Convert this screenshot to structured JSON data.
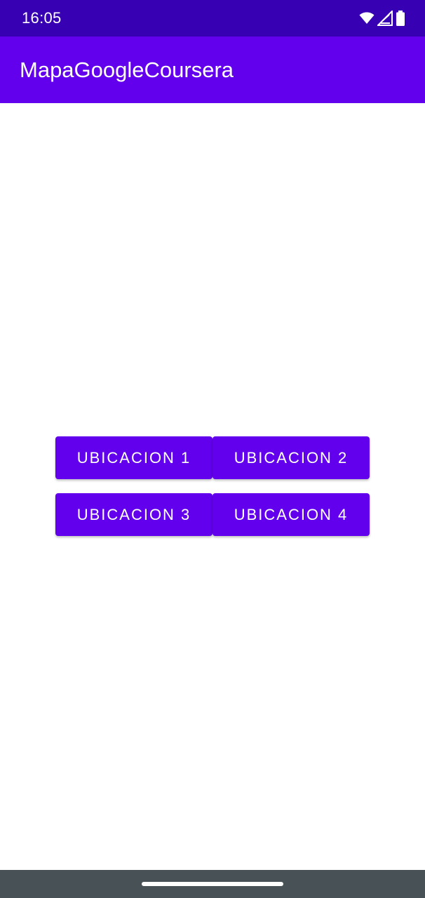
{
  "status_bar": {
    "time": "16:05",
    "icons": [
      "wifi-icon",
      "signal-icon",
      "battery-icon"
    ],
    "color": "#3700B3"
  },
  "app_bar": {
    "title": "MapaGoogleCoursera",
    "color": "#6200EE"
  },
  "buttons": [
    {
      "label": "UBICACION 1"
    },
    {
      "label": "UBICACION 2"
    },
    {
      "label": "UBICACION 3"
    },
    {
      "label": "UBICACION 4"
    }
  ],
  "nav_bar": {
    "color": "#485156",
    "icons": [
      "home-handle"
    ]
  }
}
